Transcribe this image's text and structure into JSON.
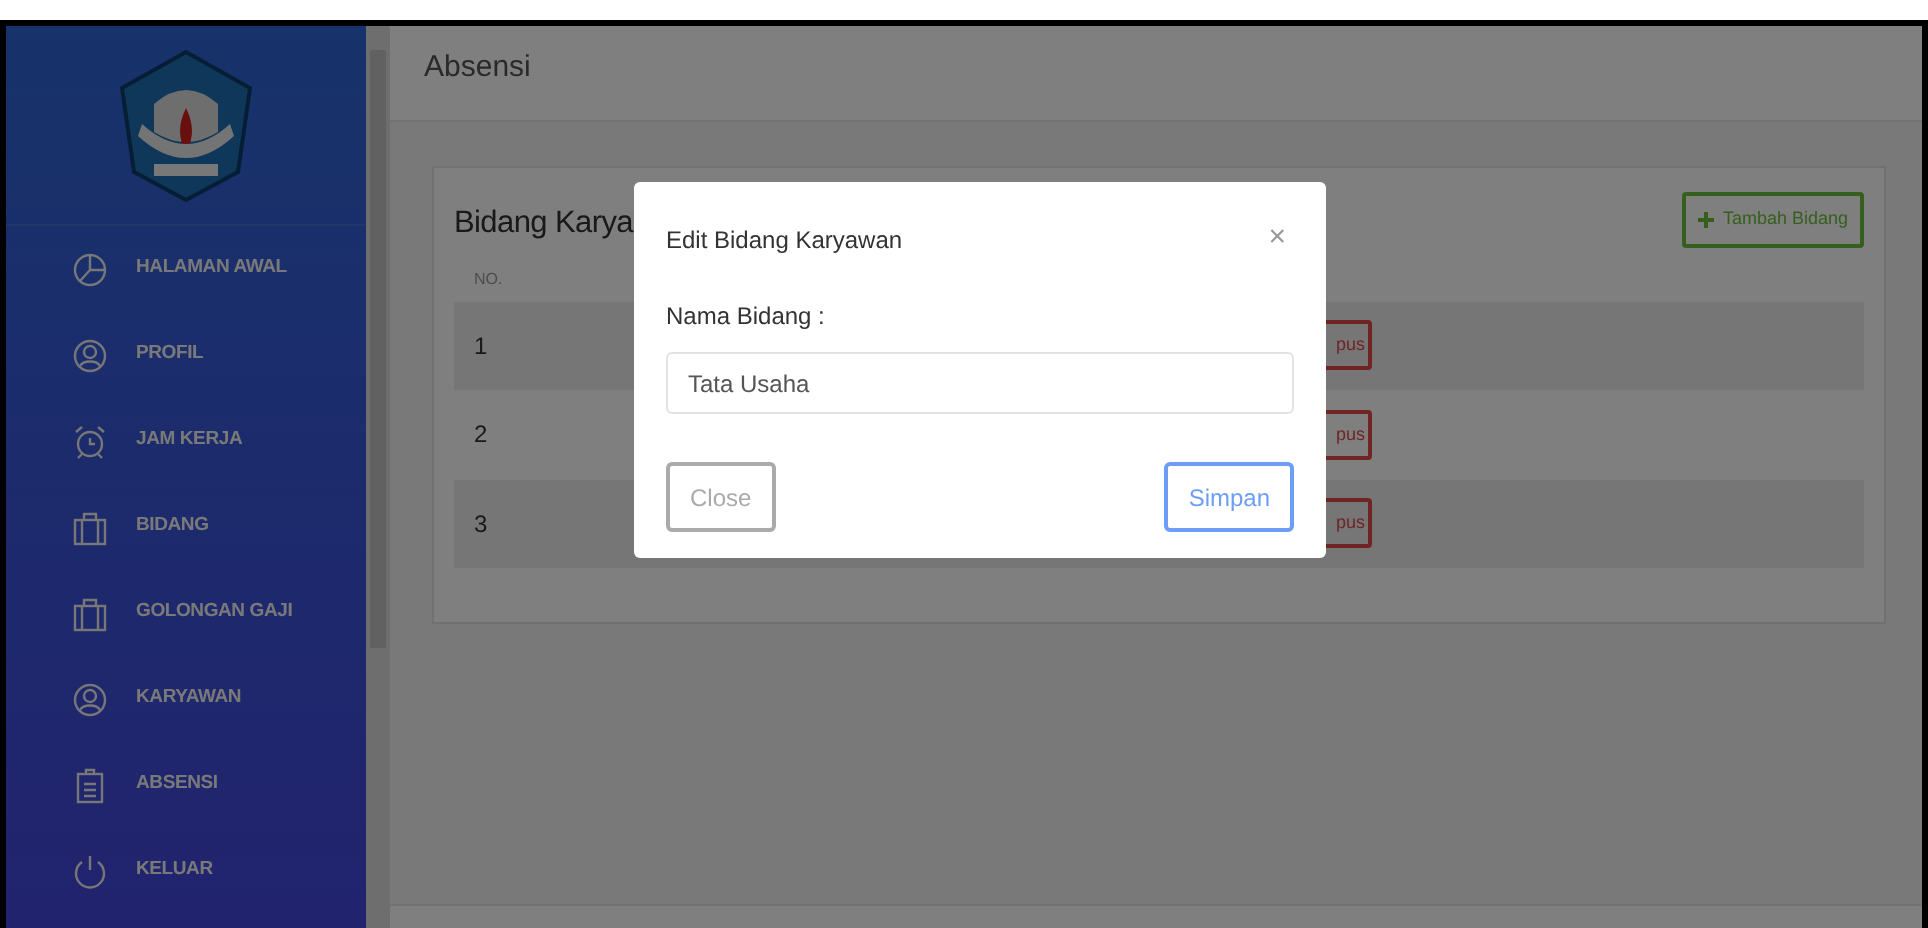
{
  "sidebar": {
    "items": [
      {
        "label": "HALAMAN AWAL",
        "kind": "pie"
      },
      {
        "label": "PROFIL",
        "kind": "user"
      },
      {
        "label": "JAM KERJA",
        "kind": "alarm"
      },
      {
        "label": "BIDANG",
        "kind": "briefcase"
      },
      {
        "label": "GOLONGAN GAJI",
        "kind": "briefcase"
      },
      {
        "label": "KARYAWAN",
        "kind": "user"
      },
      {
        "label": "ABSENSI",
        "kind": "clipboard"
      },
      {
        "label": "KELUAR",
        "kind": "power"
      }
    ]
  },
  "header": {
    "title": "Absensi"
  },
  "card": {
    "title": "Bidang Karya",
    "add_button": "Tambah Bidang",
    "table": {
      "columns": [
        "NO."
      ],
      "rows": [
        {
          "no": "1",
          "delete_button": "pus"
        },
        {
          "no": "2",
          "delete_button": "pus"
        },
        {
          "no": "3",
          "delete_button": "pus"
        }
      ]
    }
  },
  "modal": {
    "title": "Edit Bidang Karyawan",
    "close": "×",
    "field_label": "Nama Bidang :",
    "field_value": "Tata Usaha",
    "buttons": [
      {
        "label": "Close",
        "kind": "secondary"
      },
      {
        "label": "Simpan",
        "kind": "primary"
      }
    ]
  }
}
